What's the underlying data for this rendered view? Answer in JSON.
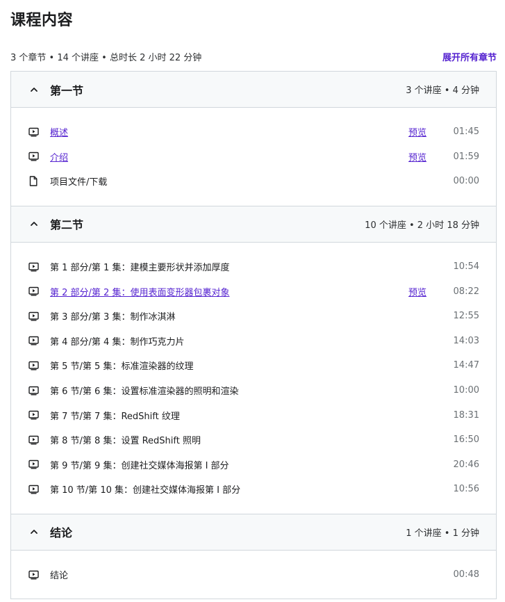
{
  "page": {
    "title": "课程内容",
    "summary": "3 个章节 • 14 个讲座 • 总时长 2 小时 22 分钟",
    "expand_all_label": "展开所有章节"
  },
  "colors": {
    "accent": "#5624d0",
    "header_bg": "#f7f9fa",
    "border": "#d1d7dc",
    "text": "#1c1d1f",
    "muted": "#6a6f73"
  },
  "sections": [
    {
      "title": "第一节",
      "meta": "3 个讲座 • 4 分钟",
      "expanded": true,
      "icon": "chevron-up-icon",
      "lectures": [
        {
          "title": "概述",
          "type": "video",
          "link": true,
          "preview": "预览",
          "duration": "01:45"
        },
        {
          "title": "介绍",
          "type": "video",
          "link": true,
          "preview": "预览",
          "duration": "01:59"
        },
        {
          "title": "项目文件/下载",
          "type": "file",
          "link": false,
          "preview": "",
          "duration": "00:00"
        }
      ]
    },
    {
      "title": "第二节",
      "meta": "10 个讲座 • 2 小时 18 分钟",
      "expanded": true,
      "icon": "chevron-up-icon",
      "lectures": [
        {
          "title": "第 1 部分/第 1 集：建模主要形状并添加厚度",
          "type": "video",
          "link": false,
          "preview": "",
          "duration": "10:54"
        },
        {
          "title": "第 2 部分/第 2 集：使用表面变形器包裹对象",
          "type": "video",
          "link": true,
          "preview": "预览",
          "duration": "08:22"
        },
        {
          "title": "第 3 部分/第 3 集：制作冰淇淋",
          "type": "video",
          "link": false,
          "preview": "",
          "duration": "12:55"
        },
        {
          "title": "第 4 部分/第 4 集：制作巧克力片",
          "type": "video",
          "link": false,
          "preview": "",
          "duration": "14:03"
        },
        {
          "title": "第 5 节/第 5 集：标准渲染器的纹理",
          "type": "video",
          "link": false,
          "preview": "",
          "duration": "14:47"
        },
        {
          "title": "第 6 节/第 6 集：设置标准渲染器的照明和渲染",
          "type": "video",
          "link": false,
          "preview": "",
          "duration": "10:00"
        },
        {
          "title": "第 7 节/第 7 集：RedShift 纹理",
          "type": "video",
          "link": false,
          "preview": "",
          "duration": "18:31"
        },
        {
          "title": "第 8 节/第 8 集：设置 RedShift 照明",
          "type": "video",
          "link": false,
          "preview": "",
          "duration": "16:50"
        },
        {
          "title": "第 9 节/第 9 集：创建社交媒体海报第 I 部分",
          "type": "video",
          "link": false,
          "preview": "",
          "duration": "20:46"
        },
        {
          "title": "第 10 节/第 10 集：创建社交媒体海报第 I 部分",
          "type": "video",
          "link": false,
          "preview": "",
          "duration": "10:56"
        }
      ]
    },
    {
      "title": "结论",
      "meta": "1 个讲座 • 1 分钟",
      "expanded": true,
      "icon": "chevron-up-icon",
      "lectures": [
        {
          "title": "结论",
          "type": "video",
          "link": false,
          "preview": "",
          "duration": "00:48"
        }
      ]
    }
  ]
}
